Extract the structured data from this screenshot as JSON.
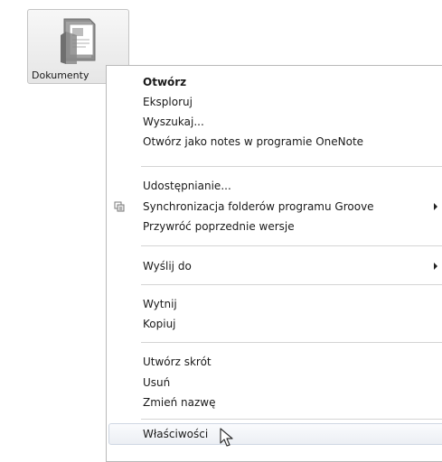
{
  "desktop": {
    "icon_label": "Dokumenty",
    "icon_name": "documents-folder-icon"
  },
  "menu": {
    "items": [
      {
        "label": "Otwórz",
        "default": true
      },
      {
        "label": "Eksploruj"
      },
      {
        "label": "Wyszukaj..."
      },
      {
        "label": "Otwórz jako notes w programie OneNote"
      },
      {
        "label": "Udostępnianie..."
      },
      {
        "label": "Synchronizacja folderów programu Groove",
        "icon": "groove-sync-icon",
        "submenu": true
      },
      {
        "label": "Przywróć poprzednie wersje"
      },
      {
        "label": "Wyślij do",
        "submenu": true
      },
      {
        "label": "Wytnij"
      },
      {
        "label": "Kopiuj"
      },
      {
        "label": "Utwórz skrót"
      },
      {
        "label": "Usuń"
      },
      {
        "label": "Zmień nazwę"
      },
      {
        "label": "Właściwości",
        "hovered": true
      }
    ]
  },
  "colors": {
    "menu_border": "#b9b9b9",
    "separator": "#d4d4d4",
    "hover_border": "#cfd7e3",
    "text": "#1a1a1a"
  }
}
